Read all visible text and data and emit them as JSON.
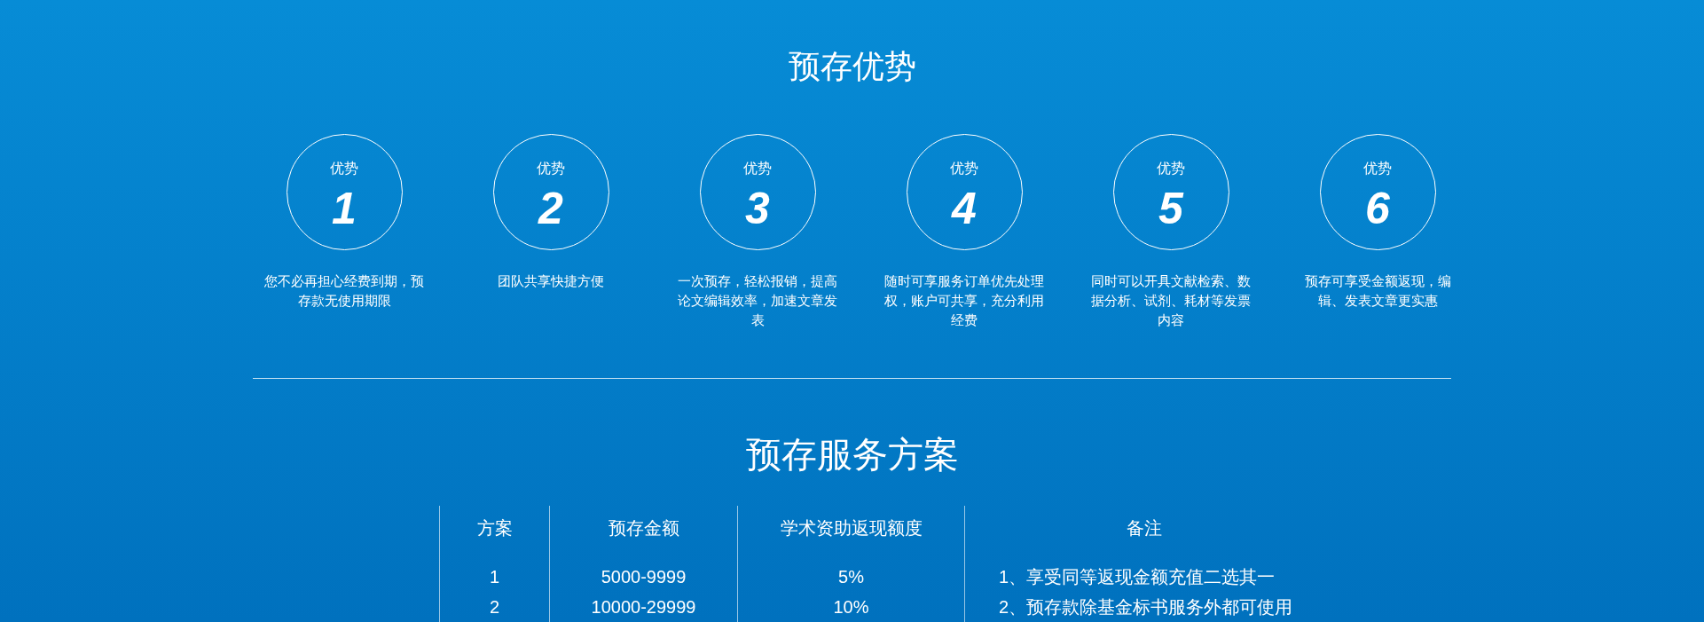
{
  "advantages_title": "预存优势",
  "advantages": [
    {
      "label": "优势",
      "number": "1",
      "description": "您不必再担心经费到期，预存款无使用期限"
    },
    {
      "label": "优势",
      "number": "2",
      "description": "团队共享快捷方便"
    },
    {
      "label": "优势",
      "number": "3",
      "description": "一次预存，轻松报销，提高论文编辑效率，加速文章发表"
    },
    {
      "label": "优势",
      "number": "4",
      "description": "随时可享服务订单优先处理权，账户可共享，充分利用经费"
    },
    {
      "label": "优势",
      "number": "5",
      "description": "同时可以开具文献检索、数据分析、试剂、耗材等发票内容"
    },
    {
      "label": "优势",
      "number": "6",
      "description": "预存可享受金额返现，编辑、发表文章更实惠"
    }
  ],
  "plans_title": "预存服务方案",
  "table": {
    "columns": [
      "方案",
      "预存金额",
      "学术资助返现额度",
      "备注"
    ],
    "rows": [
      [
        "1",
        "5000-9999",
        "5%",
        "1、享受同等返现金额充值二选其一"
      ],
      [
        "2",
        "10000-29999",
        "10%",
        "2、预存款除基金标书服务外都可使用"
      ]
    ]
  }
}
